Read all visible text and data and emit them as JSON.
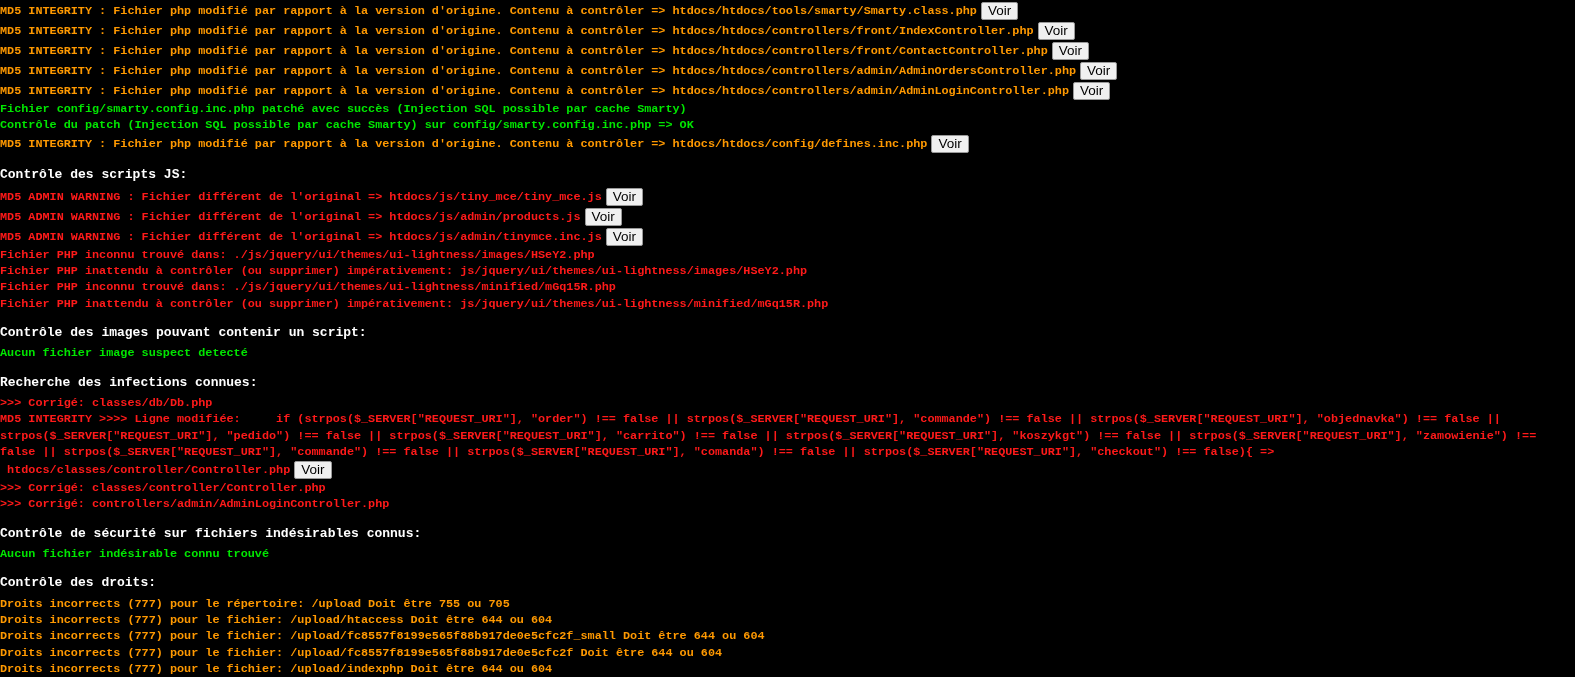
{
  "sections": [
    {
      "lines": [
        {
          "kind": "warning",
          "text": "MD5 INTEGRITY : Fichier php modifié par rapport à la version d'origine. Contenu à contrôler => htdocs/htdocs/tools/smarty/Smarty.class.php",
          "button": "Voir"
        },
        {
          "kind": "warning",
          "text": "MD5 INTEGRITY : Fichier php modifié par rapport à la version d'origine. Contenu à contrôler => htdocs/htdocs/controllers/front/IndexController.php",
          "button": "Voir"
        },
        {
          "kind": "warning",
          "text": "MD5 INTEGRITY : Fichier php modifié par rapport à la version d'origine. Contenu à contrôler => htdocs/htdocs/controllers/front/ContactController.php",
          "button": "Voir"
        },
        {
          "kind": "warning",
          "text": "MD5 INTEGRITY : Fichier php modifié par rapport à la version d'origine. Contenu à contrôler => htdocs/htdocs/controllers/admin/AdminOrdersController.php",
          "button": "Voir"
        },
        {
          "kind": "warning",
          "text": "MD5 INTEGRITY : Fichier php modifié par rapport à la version d'origine. Contenu à contrôler => htdocs/htdocs/controllers/admin/AdminLoginController.php",
          "button": "Voir"
        },
        {
          "kind": "success",
          "text": "Fichier config/smarty.config.inc.php patché avec succès (Injection SQL possible par cache Smarty)"
        },
        {
          "kind": "success",
          "text": "Contrôle du patch (Injection SQL possible par cache Smarty) sur config/smarty.config.inc.php => OK"
        },
        {
          "kind": "warning",
          "text": "MD5 INTEGRITY : Fichier php modifié par rapport à la version d'origine. Contenu à contrôler => htdocs/htdocs/config/defines.inc.php",
          "button": "Voir"
        }
      ]
    },
    {
      "heading": "Contrôle des scripts JS:",
      "lines": [
        {
          "kind": "error",
          "text": "MD5 ADMIN WARNING : Fichier différent de l'original => htdocs/js/tiny_mce/tiny_mce.js",
          "button": "Voir"
        },
        {
          "kind": "error",
          "text": "MD5 ADMIN WARNING : Fichier différent de l'original => htdocs/js/admin/products.js",
          "button": "Voir"
        },
        {
          "kind": "error",
          "text": "MD5 ADMIN WARNING : Fichier différent de l'original => htdocs/js/admin/tinymce.inc.js",
          "button": "Voir"
        },
        {
          "kind": "error",
          "text": "Fichier PHP inconnu trouvé dans: ./js/jquery/ui/themes/ui-lightness/images/HSeY2.php"
        },
        {
          "kind": "error",
          "text": "Fichier PHP inattendu à contrôler (ou supprimer) impérativement: js/jquery/ui/themes/ui-lightness/images/HSeY2.php"
        },
        {
          "kind": "error",
          "text": "Fichier PHP inconnu trouvé dans: ./js/jquery/ui/themes/ui-lightness/minified/mGq15R.php"
        },
        {
          "kind": "error",
          "text": "Fichier PHP inattendu à contrôler (ou supprimer) impérativement: js/jquery/ui/themes/ui-lightness/minified/mGq15R.php"
        }
      ]
    },
    {
      "heading": "Contrôle des images pouvant contenir un script:",
      "lines": [
        {
          "kind": "success",
          "text": "Aucun fichier image suspect detecté"
        }
      ]
    },
    {
      "heading": "Recherche des infections connues:",
      "lines": [
        {
          "kind": "error",
          "text": ">>> Corrigé: classes/db/Db.php"
        },
        {
          "kind": "error",
          "text": "MD5 INTEGRITY >>>> Ligne modifiée:     if (strpos($_SERVER[\"REQUEST_URI\"], \"order\") !== false || strpos($_SERVER[\"REQUEST_URI\"], \"commande\") !== false || strpos($_SERVER[\"REQUEST_URI\"], \"objednavka\") !== false || strpos($_SERVER[\"REQUEST_URI\"], \"pedido\") !== false || strpos($_SERVER[\"REQUEST_URI\"], \"carrito\") !== false || strpos($_SERVER[\"REQUEST_URI\"], \"koszykgt\") !== false || strpos($_SERVER[\"REQUEST_URI\"], \"zamowienie\") !== false || strpos($_SERVER[\"REQUEST_URI\"], \"commande\") !== false || strpos($_SERVER[\"REQUEST_URI\"], \"comanda\") !== false || strpos($_SERVER[\"REQUEST_URI\"], \"checkout\") !== false){ =>",
          "file": "htdocs/classes/controller/Controller.php",
          "button": "Voir"
        },
        {
          "kind": "error",
          "text": ">>> Corrigé: classes/controller/Controller.php"
        },
        {
          "kind": "error",
          "text": ">>> Corrigé: controllers/admin/AdminLoginController.php"
        }
      ]
    },
    {
      "heading": "Contrôle de sécurité sur fichiers indésirables connus:",
      "lines": [
        {
          "kind": "success",
          "text": "Aucun fichier indésirable connu trouvé"
        }
      ]
    },
    {
      "heading": "Contrôle des droits:",
      "lines": [
        {
          "kind": "warning",
          "text": "Droits incorrects (777) pour le répertoire: /upload Doit être 755 ou 705"
        },
        {
          "kind": "warning",
          "text": "Droits incorrects (777) pour le fichier: /upload/htaccess Doit être 644 ou 604"
        },
        {
          "kind": "warning",
          "text": "Droits incorrects (777) pour le fichier: /upload/fc8557f8199e565f88b917de0e5cfc2f_small Doit être 644 ou 604"
        },
        {
          "kind": "warning",
          "text": "Droits incorrects (777) pour le fichier: /upload/fc8557f8199e565f88b917de0e5cfc2f Doit être 644 ou 604"
        },
        {
          "kind": "warning",
          "text": "Droits incorrects (777) pour le fichier: /upload/indexphp Doit être 644 ou 604"
        }
      ]
    }
  ]
}
